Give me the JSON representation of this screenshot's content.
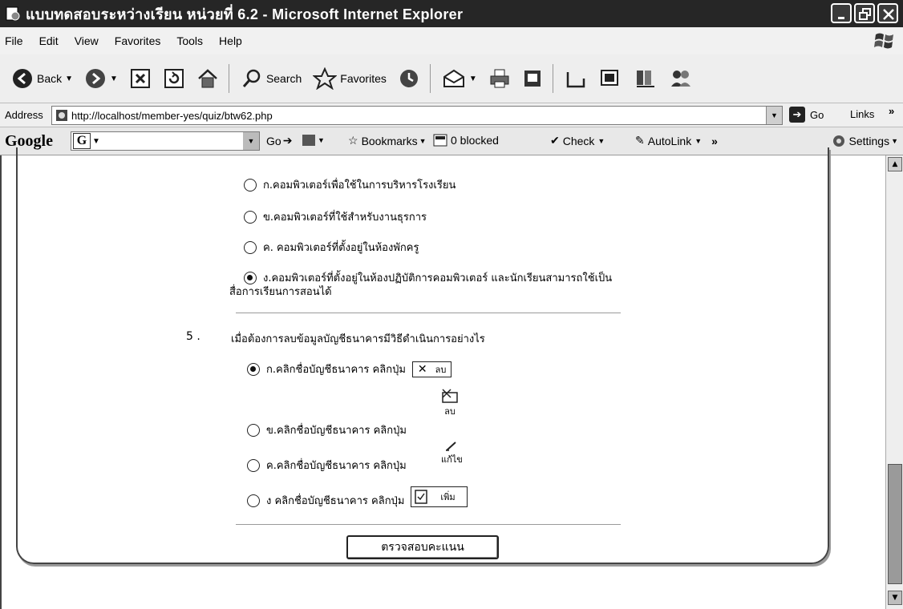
{
  "window": {
    "title": "แบบทดสอบระหว่างเรียน หน่วยที่ 6.2 - Microsoft Internet Explorer"
  },
  "menu": {
    "items": [
      "File",
      "Edit",
      "View",
      "Favorites",
      "Tools",
      "Help"
    ]
  },
  "toolbar": {
    "back_label": "Back",
    "search_label": "Search",
    "favorites_label": "Favorites"
  },
  "address": {
    "label": "Address",
    "url": "http://localhost/member-yes/quiz/btw62.php",
    "go_label": "Go",
    "links_label": "Links"
  },
  "google_toolbar": {
    "logo": "Google",
    "search_badge": "G",
    "go_label": "Go",
    "bookmarks_label": "Bookmarks",
    "blocked_label": "0 blocked",
    "check_label": "Check",
    "autolink_label": "AutoLink",
    "settings_label": "Settings"
  },
  "quiz": {
    "prev_question": {
      "options": [
        {
          "text": "ก.คอมพิวเตอร์เพื่อใช้ในการบริหารโรงเรียน",
          "checked": false
        },
        {
          "text": "ข.คอมพิวเตอร์ที่ใช้สำหรับงานธุรการ",
          "checked": false
        },
        {
          "text": "ค. คอมพิวเตอร์ที่ตั้งอยู่ในห้องพักครู",
          "checked": false
        },
        {
          "text_line1": "ง.คอมพิวเตอร์ที่ตั้งอยู่ในห้องปฏิบัติการคอมพิวเตอร์ และนักเรียนสามารถใช้เป็น",
          "text_line2": "สื่อการเรียนการสอนได้",
          "checked": true
        }
      ]
    },
    "question5": {
      "number": "5 .",
      "text": "เมื่อต้องการลบข้อมูลบัญชีธนาคารมีวิธีดำเนินการอย่างไร",
      "options": [
        {
          "text": "ก.คลิกชื่อบัญชีธนาคาร คลิกปุ่ม",
          "checked": true,
          "button_label": "ลบ"
        },
        {
          "text": "ข.คลิกชื่อบัญชีธนาคาร คลิกปุ่ม",
          "checked": false,
          "button_label": "ลบ"
        },
        {
          "text": "ค.คลิกชื่อบัญชีธนาคาร คลิกปุ่ม",
          "checked": false,
          "button_label": "แก้ไข"
        },
        {
          "text": "ง คลิกชื่อบัญชีธนาคาร คลิกปุ่ม",
          "checked": false,
          "button_label": "เพิ่ม"
        }
      ]
    },
    "submit_label": "ตรวจสอบคะแนน"
  }
}
